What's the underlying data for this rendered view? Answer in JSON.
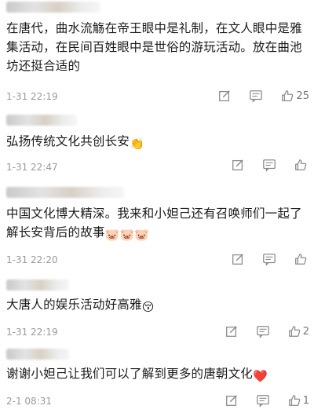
{
  "comments": [
    {
      "text": "在唐代，曲水流觞在帝王眼中是礼制，在文人眼中是雅集活动，在民间百姓眼中是世俗的游玩活动。放在曲池坊还挺合适的",
      "time": "1-31 22:19",
      "likes": "25"
    },
    {
      "text": "弘扬传统文化共创长安",
      "emoji": "👏",
      "time": "1-31 22:47",
      "likes": ""
    },
    {
      "text": "中国文化博大精深。我来和小妲己还有召唤师们一起了解长安背后的故事",
      "emoji": "🐷🐷🐷",
      "time": "1-31 22:20",
      "likes": ""
    },
    {
      "text": "大唐人的娱乐活动好高雅",
      "emoji": "😚",
      "time": "1-31 22:19",
      "likes": "2"
    },
    {
      "text": "谢谢小妲己让我们可以了解到更多的唐朝文化",
      "emoji": "❤️",
      "time": "2-1 08:31",
      "likes": "1"
    }
  ],
  "icons": {
    "edit": "edit-icon",
    "reply": "comment-reply-icon",
    "like": "thumbs-up-icon"
  },
  "colors": {
    "heart": "#e0302a",
    "meta": "#9a9a9a"
  }
}
